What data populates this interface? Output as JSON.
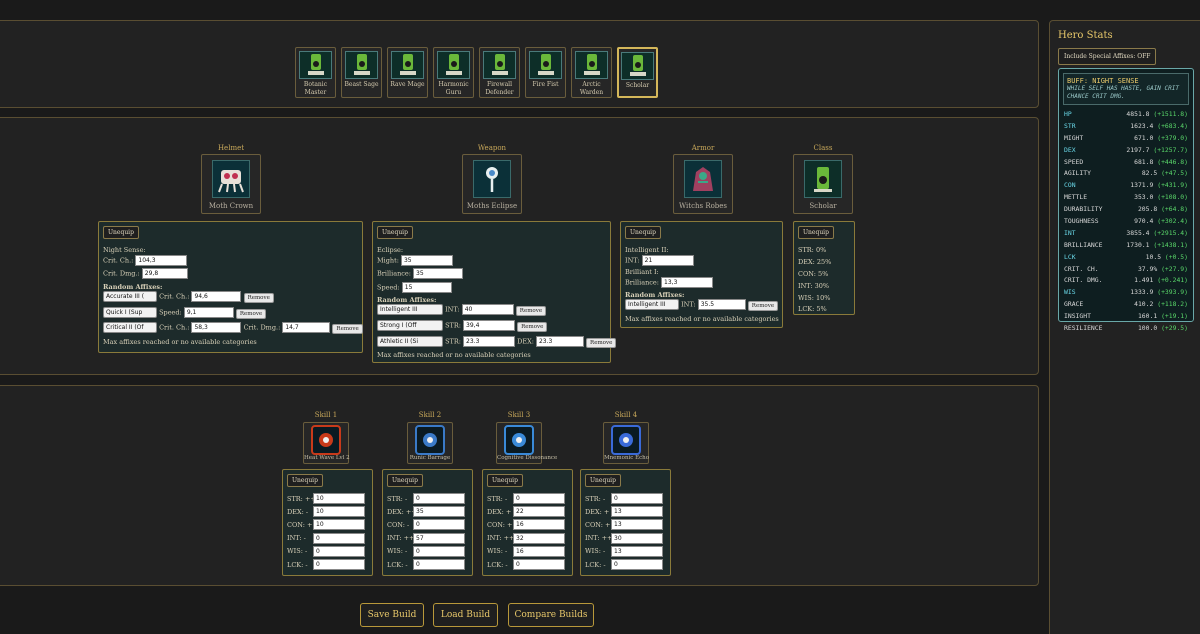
{
  "classes": [
    {
      "label": "Botanic Master",
      "icon": "botanic-master-icon"
    },
    {
      "label": "Beast Sage",
      "icon": "beast-sage-icon"
    },
    {
      "label": "Rave Mage",
      "icon": "rave-mage-icon"
    },
    {
      "label": "Harmonic Guru",
      "icon": "harmonic-guru-icon"
    },
    {
      "label": "Firewall Defender",
      "icon": "firewall-defender-icon"
    },
    {
      "label": "Fire Fist",
      "icon": "fire-fist-icon"
    },
    {
      "label": "Arctic Warden",
      "icon": "arctic-warden-icon"
    },
    {
      "label": "Scholar",
      "icon": "scholar-icon"
    }
  ],
  "selected_class": "Scholar",
  "equipment": {
    "helmet": {
      "slot_title": "Helmet",
      "item_name": "Moth Crown",
      "unequip": "Unequip",
      "affix_name": "Night Sense:",
      "stats": [
        {
          "label": "Crit. Ch.:",
          "value": "104,3"
        },
        {
          "label": "Crit. Dmg.:",
          "value": "29,8"
        }
      ],
      "random_title": "Random Affixes:",
      "random": [
        {
          "select": "Accurate III (",
          "f1": "Crit. Ch.:",
          "v1": "94,6"
        },
        {
          "select": "Quick I (Sup",
          "f1": "Speed:",
          "v1": "9,1"
        },
        {
          "select": "Critical II (Of",
          "f1": "Crit. Ch.:",
          "v1": "58,3",
          "f2": "Crit. Dmg.:",
          "v2": "14,7"
        }
      ],
      "remove": "Remove",
      "max_note": "Max affixes reached or no available categories"
    },
    "weapon": {
      "slot_title": "Weapon",
      "item_name": "Moths Eclipse",
      "unequip": "Unequip",
      "affix_name": "Eclipse:",
      "stats": [
        {
          "label": "Might:",
          "value": "35"
        },
        {
          "label": "Brilliance:",
          "value": "35"
        },
        {
          "label": "Speed:",
          "value": "15"
        }
      ],
      "random_title": "Random Affixes:",
      "random": [
        {
          "select": "Intelligent III",
          "f1": "INT:",
          "v1": "40"
        },
        {
          "select": "Strong I (Off",
          "f1": "STR:",
          "v1": "39,4"
        },
        {
          "select": "Athletic II (Si",
          "f1": "STR:",
          "v1": "23.3",
          "f2": "DEX:",
          "v2": "23.3"
        }
      ],
      "remove": "Remove",
      "max_note": "Max affixes reached or no available categories"
    },
    "armor": {
      "slot_title": "Armor",
      "item_name": "Witchs Robes",
      "unequip": "Unequip",
      "affix_name": "Intelligent II:",
      "stats": [
        {
          "label": "INT:",
          "value": "21"
        }
      ],
      "affix2_name": "Brilliant I:",
      "stats2": [
        {
          "label": "Brilliance:",
          "value": "13,3"
        }
      ],
      "random_title": "Random Affixes:",
      "random": [
        {
          "select": "Intelligent III",
          "f1": "INT:",
          "v1": "35.5"
        }
      ],
      "remove": "Remove",
      "max_note": "Max affixes reached or no available categories"
    },
    "class": {
      "slot_title": "Class",
      "item_name": "Scholar",
      "unequip": "Unequip",
      "bonuses": [
        "STR: 0%",
        "DEX: 25%",
        "CON: 5%",
        "INT: 30%",
        "WIS: 10%",
        "LCK: 5%"
      ]
    }
  },
  "skills": [
    {
      "title": "Skill 1",
      "name": "Heat Wave Lvl 2",
      "unequip": "Unequip",
      "stats": [
        {
          "label": "STR: ++",
          "value": "10"
        },
        {
          "label": "DEX: -",
          "value": "10"
        },
        {
          "label": "CON: ++",
          "value": "10"
        },
        {
          "label": "INT: -",
          "value": "0"
        },
        {
          "label": "WIS: -",
          "value": "0"
        },
        {
          "label": "LCK: -",
          "value": "0"
        }
      ]
    },
    {
      "title": "Skill 2",
      "name": "Runic Barrage",
      "unequip": "Unequip",
      "stats": [
        {
          "label": "STR: -",
          "value": "0"
        },
        {
          "label": "DEX: ++",
          "value": "35"
        },
        {
          "label": "CON: -",
          "value": "0"
        },
        {
          "label": "INT: +++",
          "value": "57"
        },
        {
          "label": "WIS: -",
          "value": "0"
        },
        {
          "label": "LCK: -",
          "value": "0"
        }
      ]
    },
    {
      "title": "Skill 3",
      "name": "Cognitive Dissonance",
      "unequip": "Unequip",
      "stats": [
        {
          "label": "STR: -",
          "value": "0"
        },
        {
          "label": "DEX: +",
          "value": "22"
        },
        {
          "label": "CON: +",
          "value": "16"
        },
        {
          "label": "INT: +++",
          "value": "32"
        },
        {
          "label": "WIS: -",
          "value": "16"
        },
        {
          "label": "LCK: -",
          "value": "0"
        }
      ]
    },
    {
      "title": "Skill 4",
      "name": "Mnemonic Echo",
      "unequip": "Unequip",
      "stats": [
        {
          "label": "STR: -",
          "value": "0"
        },
        {
          "label": "DEX: +",
          "value": "13"
        },
        {
          "label": "CON: +",
          "value": "13"
        },
        {
          "label": "INT: +++",
          "value": "30"
        },
        {
          "label": "WIS: -",
          "value": "13"
        },
        {
          "label": "LCK: -",
          "value": "0"
        }
      ]
    }
  ],
  "actions": {
    "save": "Save Build",
    "load": "Load Build",
    "compare": "Compare Builds"
  },
  "hero_stats": {
    "title": "Hero Stats",
    "toggle": "Include Special Affixes: OFF",
    "buff_title": "BUFF: NIGHT SENSE",
    "buff_desc": "WHILE SELF HAS HASTE, GAIN CRIT CHANCE CRIT DMG.",
    "rows": [
      {
        "name": "HP",
        "value": "4851.8",
        "bonus": "(+1511.8)",
        "color": "#6ad8e8"
      },
      {
        "name": "STR",
        "value": "1623.4",
        "bonus": "(+683.4)",
        "color": "#6ad8e8"
      },
      {
        "name": "MIGHT",
        "value": "671.0",
        "bonus": "(+379.0)",
        "color": "#d8d8d8"
      },
      {
        "name": "DEX",
        "value": "2197.7",
        "bonus": "(+1257.7)",
        "color": "#6ad8e8"
      },
      {
        "name": "SPEED",
        "value": "681.8",
        "bonus": "(+446.8)",
        "color": "#d8d8d8"
      },
      {
        "name": "AGILITY",
        "value": "82.5",
        "bonus": "(+47.5)",
        "color": "#d8d8d8"
      },
      {
        "name": "CON",
        "value": "1371.9",
        "bonus": "(+431.9)",
        "color": "#6ad8e8"
      },
      {
        "name": "METTLE",
        "value": "353.0",
        "bonus": "(+108.0)",
        "color": "#d8d8d8"
      },
      {
        "name": "DURABILITY",
        "value": "205.8",
        "bonus": "(+64.8)",
        "color": "#d8d8d8"
      },
      {
        "name": "TOUGHNESS",
        "value": "970.4",
        "bonus": "(+302.4)",
        "color": "#d8d8d8"
      },
      {
        "name": "INT",
        "value": "3855.4",
        "bonus": "(+2915.4)",
        "color": "#6ad8e8"
      },
      {
        "name": "BRILLIANCE",
        "value": "1730.1",
        "bonus": "(+1438.1)",
        "color": "#d8d8d8"
      },
      {
        "name": "LCK",
        "value": "10.5",
        "bonus": "(+0.5)",
        "color": "#6ad8e8"
      },
      {
        "name": "CRIT. CH.",
        "value": "37.9%",
        "bonus": "(+27.9)",
        "color": "#d8d8d8"
      },
      {
        "name": "CRIT. DMG.",
        "value": "1.491",
        "bonus": "(+0.241)",
        "color": "#d8d8d8"
      },
      {
        "name": "WIS",
        "value": "1333.9",
        "bonus": "(+393.9)",
        "color": "#6ad8e8"
      },
      {
        "name": "GRACE",
        "value": "410.2",
        "bonus": "(+118.2)",
        "color": "#d8d8d8"
      },
      {
        "name": "INSIGHT",
        "value": "160.1",
        "bonus": "(+19.1)",
        "color": "#d8d8d8"
      },
      {
        "name": "RESILIENCE",
        "value": "100.0",
        "bonus": "(+29.5)",
        "color": "#d8d8d8"
      }
    ]
  }
}
